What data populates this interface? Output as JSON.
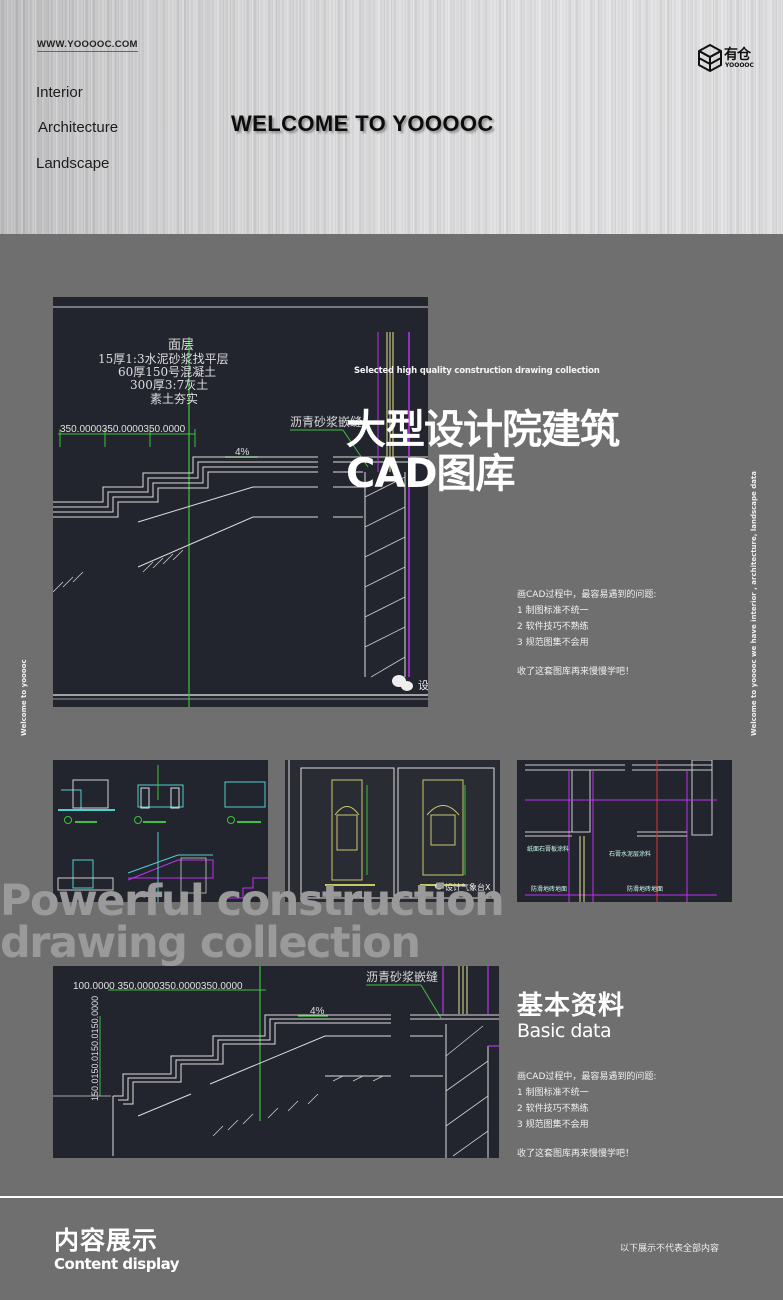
{
  "header": {
    "site_url": "WWW.YOOOOC.COM",
    "nav": [
      "Interior",
      "Architecture",
      "Landscape"
    ],
    "welcome": "WELCOME TO YOOOOC",
    "logo": {
      "cn": "有仓",
      "en": "YOOOOC",
      "icon": "stacked-cube-icon"
    }
  },
  "hero": {
    "tagline": "Selected high quality construction drawing collection",
    "title_line1": "大型设计院建筑",
    "title_line2": "CAD图库",
    "description": {
      "intro": "画CAD过程中，最容易遇到的问题:",
      "items": [
        "1 制图标准不统一",
        "2 软件技巧不熟练",
        "3 规范图集不会用"
      ],
      "outro": "收了这套图库再来慢慢学吧！"
    }
  },
  "side": {
    "left": "Welcome to yooooc",
    "right": "Welcome to yooooc  we have interior , architecture, landscape data"
  },
  "cad_main": {
    "layers": [
      "面层",
      "15厚1:3水泥砂浆找平层",
      "60厚150号混凝土",
      "300厚3:7灰土",
      "素土夯实"
    ],
    "dimensions": "350.0000350.0000350.0000",
    "slope": "4%",
    "joint_label": "沥青砂浆嵌缝",
    "watermark_icon": "wechat-icon",
    "watermark": "设"
  },
  "thumbnails": [
    {
      "name": "landscape-details"
    },
    {
      "name": "facade-elevations",
      "watermark": "设计气象台X"
    },
    {
      "name": "wall-sections",
      "labels": [
        "纸面石膏板涂料",
        "石膏水泥层涂料",
        "防滑地砖地面",
        "防滑地砖地面"
      ]
    }
  ],
  "watermark_text": {
    "line1": "Powerful construction",
    "line2": "drawing collection"
  },
  "cad_bottom": {
    "dimensions": "100.0000  350.0000350.0000350.0000",
    "slope": "4%",
    "joint_label": "沥青砂浆嵌缝",
    "vertical_dims": "150.0150.0150.0150.0000"
  },
  "basic": {
    "title_cn": "基本资料",
    "title_en": "Basic data",
    "description": {
      "intro": "画CAD过程中，最容易遇到的问题:",
      "items": [
        "1 制图标准不统一",
        "2 软件技巧不熟练",
        "3 规范图集不会用"
      ],
      "outro": "收了这套图库再来慢慢学吧！"
    }
  },
  "content_display": {
    "title_cn": "内容展示",
    "title_en": "Content display",
    "note": "以下展示不代表全部内容"
  }
}
